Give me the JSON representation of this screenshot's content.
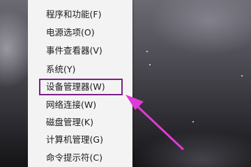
{
  "menu": {
    "items": [
      {
        "label": "程序和功能(F)"
      },
      {
        "label": "电源选项(O)"
      },
      {
        "label": "事件查看器(V)"
      },
      {
        "label": "系统(Y)"
      },
      {
        "label": "设备管理器(W)"
      },
      {
        "label": "网络连接(W)"
      },
      {
        "label": "磁盘管理(K)"
      },
      {
        "label": "计算机管理(G)"
      },
      {
        "label": "命令提示符(C)"
      }
    ],
    "highlighted_item": "设备管理器(W)"
  },
  "annotation": {
    "highlight_color": "#7a1f86",
    "arrow_color": "#e03ad8",
    "arrow_icon": "pointer-arrow-icon"
  }
}
